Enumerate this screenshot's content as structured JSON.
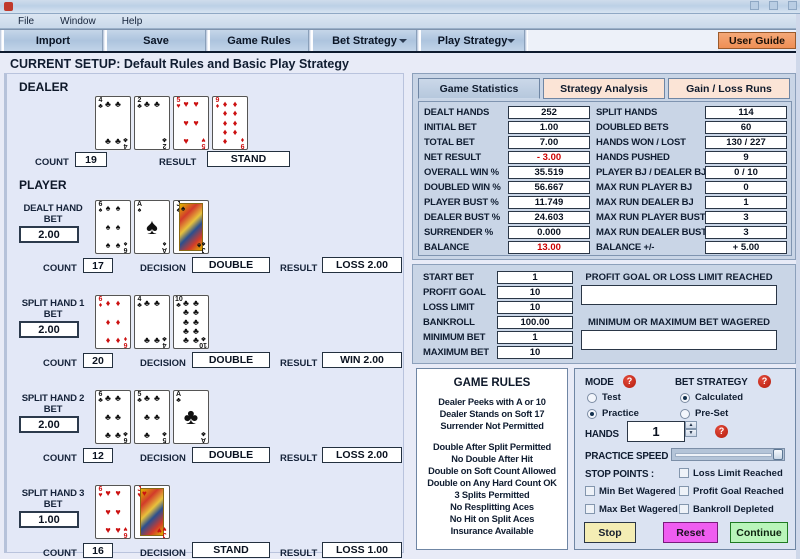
{
  "window": {
    "title": ""
  },
  "menu": {
    "items": [
      "File",
      "Window",
      "Help"
    ]
  },
  "toolbar": {
    "import": "Import",
    "save": "Save",
    "game_rules": "Game Rules",
    "bet_strategy": "Bet Strategy",
    "play_strategy": "Play Strategy",
    "user_guide": "User Guide"
  },
  "setup": {
    "line": "CURRENT SETUP: Default Rules and Basic Play Strategy"
  },
  "table": {
    "dealer_title": "DEALER",
    "player_title": "PLAYER",
    "count_label": "COUNT",
    "result_label": "RESULT",
    "decision_label": "DECISION",
    "bet_label": "BET",
    "dealer": {
      "cards": [
        {
          "rank": "4",
          "suit": "clubs",
          "color": "blk"
        },
        {
          "rank": "2",
          "suit": "clubs",
          "color": "blk"
        },
        {
          "rank": "5",
          "suit": "hearts",
          "color": "red"
        },
        {
          "rank": "9",
          "suit": "diamonds",
          "color": "red"
        }
      ],
      "count": "19",
      "result": "STAND"
    },
    "hands": [
      {
        "label": "DEALT HAND",
        "bet": "2.00",
        "cards": [
          {
            "rank": "6",
            "suit": "spades",
            "color": "blk"
          },
          {
            "rank": "A",
            "suit": "spades",
            "color": "blk"
          },
          {
            "rank": "J",
            "suit": "spades",
            "color": "blk",
            "face": true
          }
        ],
        "count": "17",
        "decision": "DOUBLE",
        "result": "LOSS  2.00"
      },
      {
        "label": "SPLIT HAND 1",
        "bet": "2.00",
        "cards": [
          {
            "rank": "6",
            "suit": "diamonds",
            "color": "red"
          },
          {
            "rank": "4",
            "suit": "clubs",
            "color": "blk"
          },
          {
            "rank": "10",
            "suit": "clubs",
            "color": "blk"
          }
        ],
        "count": "20",
        "decision": "DOUBLE",
        "result": "WIN  2.00"
      },
      {
        "label": "SPLIT HAND 2",
        "bet": "2.00",
        "cards": [
          {
            "rank": "6",
            "suit": "clubs",
            "color": "blk"
          },
          {
            "rank": "5",
            "suit": "clubs",
            "color": "blk"
          },
          {
            "rank": "A",
            "suit": "clubs",
            "color": "blk"
          }
        ],
        "count": "12",
        "decision": "DOUBLE",
        "result": "LOSS  2.00"
      },
      {
        "label": "SPLIT HAND 3",
        "bet": "1.00",
        "cards": [
          {
            "rank": "6",
            "suit": "hearts",
            "color": "red"
          },
          {
            "rank": "J",
            "suit": "hearts",
            "color": "red",
            "face": true
          }
        ],
        "count": "16",
        "decision": "STAND",
        "result": "LOSS  1.00"
      }
    ]
  },
  "stats": {
    "tabs": [
      {
        "label": "Game Statistics",
        "active": true
      },
      {
        "label": "Strategy Analysis",
        "active": false
      },
      {
        "label": "Gain / Loss Runs",
        "active": false
      }
    ],
    "left": [
      {
        "label": "DEALT HANDS",
        "value": "252"
      },
      {
        "label": "INITIAL BET",
        "value": "1.00"
      },
      {
        "label": "TOTAL BET",
        "value": "7.00"
      },
      {
        "label": "NET RESULT",
        "value": "- 3.00",
        "negative": true
      },
      {
        "label": "OVERALL WIN %",
        "value": "35.519"
      },
      {
        "label": "DOUBLED WIN %",
        "value": "56.667"
      },
      {
        "label": "PLAYER BUST %",
        "value": "11.749"
      },
      {
        "label": "DEALER BUST %",
        "value": "24.603"
      },
      {
        "label": "SURRENDER  %",
        "value": "0.000"
      },
      {
        "label": "BALANCE",
        "value": "13.00",
        "negative": true
      }
    ],
    "right": [
      {
        "label": "SPLIT HANDS",
        "value": "114"
      },
      {
        "label": "DOUBLED BETS",
        "value": "60"
      },
      {
        "label": "HANDS WON / LOST",
        "value": "130 / 227"
      },
      {
        "label": "HANDS PUSHED",
        "value": "9"
      },
      {
        "label": "PLAYER BJ / DEALER BJ",
        "value": "0 / 10"
      },
      {
        "label": "MAX RUN PLAYER BJ",
        "value": "0"
      },
      {
        "label": "MAX RUN DEALER BJ",
        "value": "1"
      },
      {
        "label": "MAX RUN PLAYER BUST",
        "value": "3"
      },
      {
        "label": "MAX RUN DEALER BUST",
        "value": "3"
      },
      {
        "label": "BALANCE  +/-",
        "value": "+ 5.00"
      }
    ]
  },
  "betting": {
    "fields": [
      {
        "label": "START BET",
        "value": "1"
      },
      {
        "label": "PROFIT GOAL",
        "value": "10"
      },
      {
        "label": "LOSS LIMIT",
        "value": "10"
      },
      {
        "label": "BANKROLL",
        "value": "100.00"
      },
      {
        "label": "MINIMUM BET",
        "value": "1"
      },
      {
        "label": "MAXIMUM BET",
        "value": "10"
      }
    ],
    "msg1_label": "PROFIT GOAL OR LOSS LIMIT REACHED",
    "msg1_value": "",
    "msg2_label": "MINIMUM OR MAXIMUM BET WAGERED",
    "msg2_value": ""
  },
  "rules": {
    "title": "GAME RULES",
    "group1": [
      "Dealer Peeks with A or 10",
      "Dealer Stands on Soft 17",
      "Surrender Not Permitted"
    ],
    "group2": [
      "Double After Split Permitted",
      "No Double After Hit",
      "Double on Soft Count Allowed",
      "Double on Any Hard Count OK",
      "3 Splits Permitted",
      "No Resplitting Aces",
      "No Hit on Split Aces",
      "Insurance Available"
    ]
  },
  "controls": {
    "mode_label": "MODE",
    "mode_options": [
      {
        "label": "Test",
        "selected": false
      },
      {
        "label": "Practice",
        "selected": true
      }
    ],
    "bet_strategy_label": "BET STRATEGY",
    "bet_strategy_options": [
      {
        "label": "Calculated",
        "selected": true
      },
      {
        "label": "Pre-Set",
        "selected": false
      }
    ],
    "hands_label": "HANDS",
    "hands_value": "1",
    "practice_speed_label": "PRACTICE SPEED",
    "practice_speed_value": 100,
    "stop_points_label": "STOP POINTS :",
    "checkboxes": [
      {
        "label": "Loss Limit Reached",
        "checked": false
      },
      {
        "label": "Min Bet Wagered",
        "checked": false
      },
      {
        "label": "Profit Goal Reached",
        "checked": false
      },
      {
        "label": "Max Bet Wagered",
        "checked": false
      },
      {
        "label": "Bankroll Depleted",
        "checked": false
      }
    ],
    "stop_button": "Stop",
    "reset_button": "Reset",
    "continue_button": "Continue",
    "help_glyph": "?"
  },
  "colors": {
    "accent_orange": "#ef8f55",
    "negative": "#cc0000",
    "panel": "#c9d5e6",
    "background": "#e8ebf7"
  }
}
